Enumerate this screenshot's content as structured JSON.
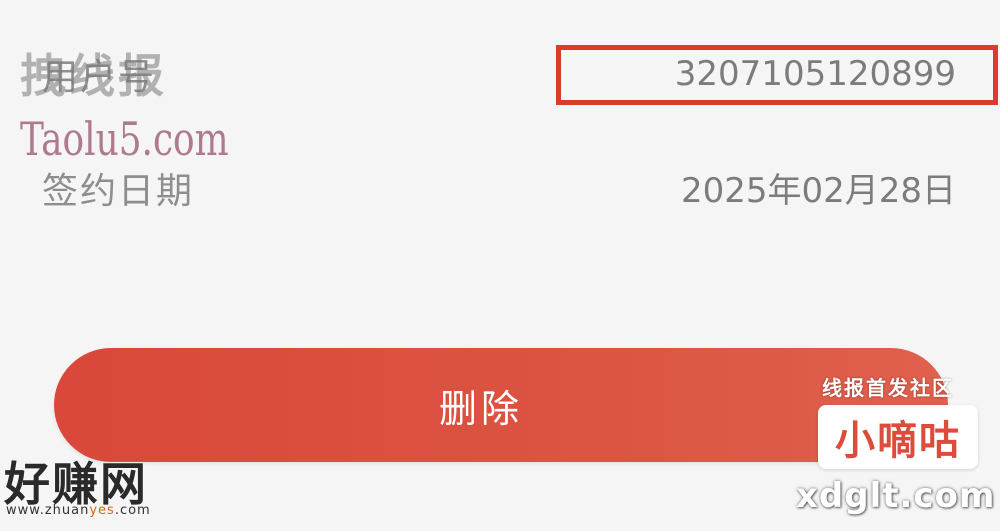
{
  "rows": {
    "user_no": {
      "label": "用户号",
      "value": "3207105120899"
    },
    "sign_date": {
      "label": "签约日期",
      "value": "2025年02月28日"
    }
  },
  "actions": {
    "delete_label": "删除"
  },
  "colors": {
    "background": "#f5f5f5",
    "accent": "#dd3b2a",
    "button": "#db4d3d",
    "label_text": "#8e8e8e",
    "value_text": "#7c7c7c"
  },
  "watermarks": {
    "top_left_text": "拽线报",
    "taolu": "Taolu5.com",
    "right_caption": "线报首发社区",
    "right_brand": "小嘀咕",
    "right_domain": "xdglt.com",
    "left_brand": "好赚网",
    "left_domain_prefix": "www.zhuan",
    "left_domain_accent": "yes",
    "left_domain_suffix": ".com"
  }
}
